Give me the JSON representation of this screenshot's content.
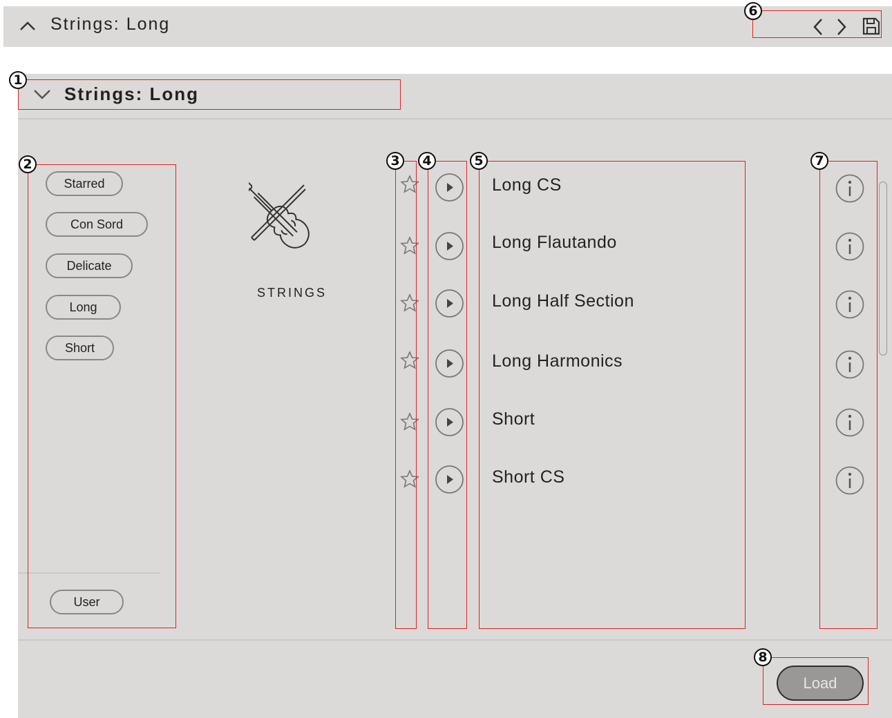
{
  "topbar": {
    "title": "Strings: Long"
  },
  "panel": {
    "title": "Strings: Long",
    "instrument_label": "STRINGS"
  },
  "tags": [
    "Starred",
    "Con Sord",
    "Delicate",
    "Long",
    "Short"
  ],
  "user_tag": "User",
  "presets": [
    "Long CS",
    "Long Flautando",
    "Long Half Section",
    "Long Harmonics",
    "Short",
    "Short CS"
  ],
  "load_label": "Load",
  "callouts": [
    "1",
    "2",
    "3",
    "4",
    "5",
    "6",
    "7",
    "8"
  ],
  "icons": {
    "collapse": "chevron-up-icon",
    "expand": "chevron-down-icon",
    "prev": "chevron-left-icon",
    "next": "chevron-right-icon",
    "save": "floppy-disk-icon",
    "star": "star-icon",
    "play": "play-icon",
    "info": "info-icon",
    "instrument": "violin-icon"
  },
  "colors": {
    "annotation": "#e02020",
    "panel": "#dcdad8",
    "load_button": "#9a9896"
  }
}
